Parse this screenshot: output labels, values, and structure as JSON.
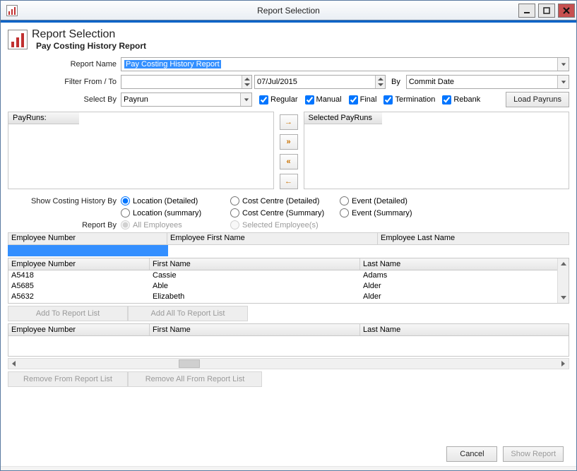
{
  "window": {
    "title": "Report Selection"
  },
  "header": {
    "title": "Report Selection",
    "subtitle": "Pay Costing History Report"
  },
  "labels": {
    "report_name": "Report Name",
    "filter_from_to": "Filter From / To",
    "by": "By",
    "select_by": "Select By",
    "payruns": "PayRuns:",
    "selected_payruns": "Selected PayRuns",
    "show_costing_by": "Show Costing History By",
    "report_by": "Report By"
  },
  "report_name": {
    "selected": "Pay Costing History Report"
  },
  "filter": {
    "from": "",
    "to": "07/Jul/2015",
    "by_selected": "Commit Date"
  },
  "select_by": {
    "value": "Payrun"
  },
  "checkboxes": {
    "regular": {
      "label": "Regular",
      "checked": true
    },
    "manual": {
      "label": "Manual",
      "checked": true
    },
    "final": {
      "label": "Final",
      "checked": true
    },
    "termination": {
      "label": "Termination",
      "checked": true
    },
    "rebank": {
      "label": "Rebank",
      "checked": true
    }
  },
  "buttons": {
    "load_payruns": "Load Payruns",
    "add_to_list": "Add To Report List",
    "add_all": "Add All To Report List",
    "remove": "Remove From Report List",
    "remove_all": "Remove All From Report List",
    "cancel": "Cancel",
    "show_report": "Show Report"
  },
  "costing_history_options": {
    "loc_detail": "Location (Detailed)",
    "cc_detail": "Cost Centre (Detailed)",
    "ev_detail": "Event (Detailed)",
    "loc_sum": "Location (summary)",
    "cc_sum": "Cost Centre (Summary)",
    "ev_sum": "Event (Summary)",
    "selected": "loc_detail"
  },
  "report_by_options": {
    "all": "All Employees",
    "selected_emp": "Selected Employee(s)"
  },
  "filter_headers": {
    "emp_no": "Employee Number",
    "emp_first": "Employee First Name",
    "emp_last": "Employee Last Name"
  },
  "grid1": {
    "headers": {
      "c1": "Employee Number",
      "c2": "First Name",
      "c3": "Last Name"
    },
    "rows": [
      {
        "c1": "A5418",
        "c2": "Cassie",
        "c3": "Adams"
      },
      {
        "c1": "A5685",
        "c2": "Able",
        "c3": "Alder"
      },
      {
        "c1": "A5632",
        "c2": "Elizabeth",
        "c3": "Alder"
      }
    ]
  },
  "grid2": {
    "headers": {
      "c1": "Employee Number",
      "c2": "First Name",
      "c3": "Last Name"
    }
  }
}
